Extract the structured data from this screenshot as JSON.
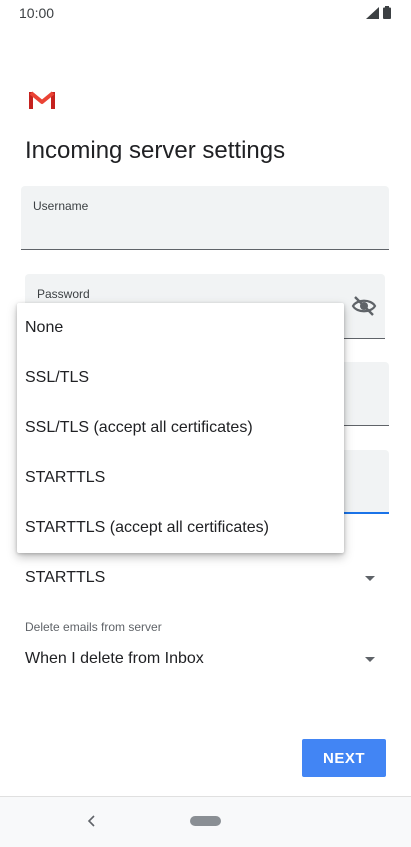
{
  "status_bar": {
    "time": "10:00"
  },
  "page": {
    "title": "Incoming server settings"
  },
  "fields": {
    "username_label": "Username",
    "password_label": "Password"
  },
  "security_menu": {
    "options": [
      "None",
      "SSL/TLS",
      "SSL/TLS (accept all certificates)",
      "STARTTLS",
      "STARTTLS (accept all certificates)"
    ]
  },
  "security_select": {
    "value": "STARTTLS"
  },
  "delete_select": {
    "label": "Delete emails from server",
    "value": "When I delete from Inbox"
  },
  "buttons": {
    "next": "NEXT"
  },
  "colors": {
    "accent": "#4285f4",
    "focus_underline": "#1a73e8",
    "gmail_red": "#ea4335"
  }
}
